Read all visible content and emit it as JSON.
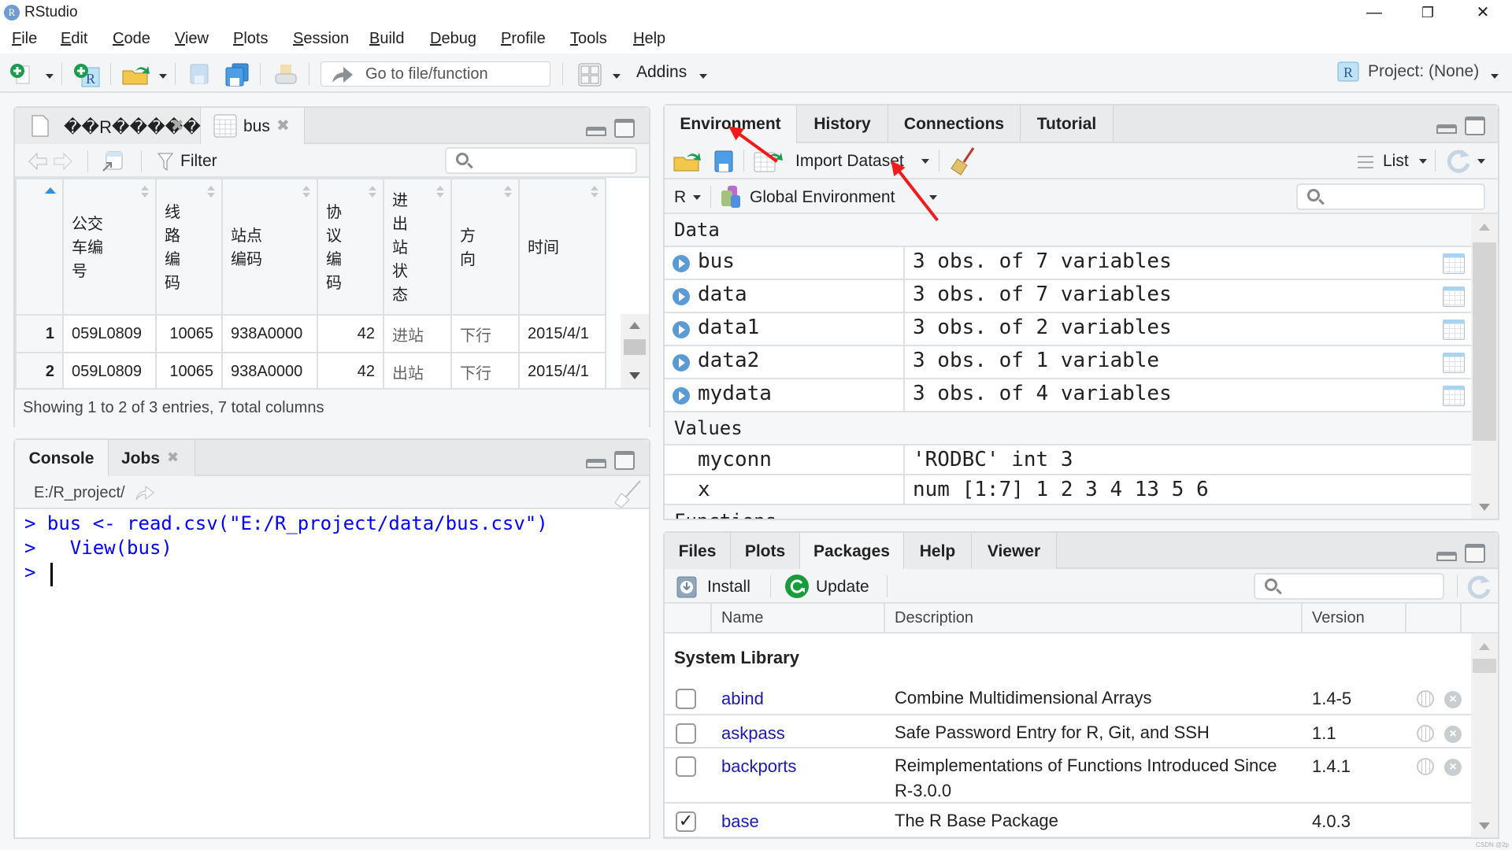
{
  "window": {
    "title": "RStudio",
    "logo": "R",
    "controls": {
      "minimize": "—",
      "restore": "❐",
      "close": "✕"
    }
  },
  "menu": [
    {
      "key": "F",
      "rest": "ile"
    },
    {
      "key": "E",
      "rest": "dit"
    },
    {
      "key": "C",
      "rest": "ode"
    },
    {
      "key": "V",
      "rest": "iew"
    },
    {
      "key": "P",
      "rest": "lots"
    },
    {
      "key": "S",
      "rest": "ession"
    },
    {
      "key": "B",
      "rest": "uild"
    },
    {
      "key": "D",
      "rest": "ebug"
    },
    {
      "key": "P",
      "rest": "rofile"
    },
    {
      "key": "T",
      "rest": "ools"
    },
    {
      "key": "H",
      "rest": "elp"
    }
  ],
  "toolbar": {
    "goto_placeholder": "Go to file/function",
    "addins_label": "Addins",
    "project_label": "Project: (None)"
  },
  "source_pane": {
    "tabs": [
      {
        "label": "��R�����",
        "icon": "file-icon",
        "closable": true
      },
      {
        "label": "bus",
        "icon": "table-icon",
        "closable": true,
        "active": true
      }
    ],
    "filter_label": "Filter",
    "search_placeholder": "",
    "columns": [
      "",
      "公交\n车编\n号",
      "线\n路\n编\n码",
      "站点\n编码",
      "协\n议\n编\n码",
      "进\n出\n站\n状\n态",
      "方\n向",
      "时间"
    ],
    "rows": [
      {
        "n": "1",
        "cells": [
          "059L0809",
          "10065",
          "938A0000",
          "42",
          "进站",
          "下行",
          "2015/4/1"
        ]
      },
      {
        "n": "2",
        "cells": [
          "059L0809",
          "10065",
          "938A0000",
          "42",
          "出站",
          "下行",
          "2015/4/1"
        ]
      }
    ],
    "footer": "Showing 1 to 2 of 3 entries, 7 total columns"
  },
  "console_pane": {
    "tabs": [
      {
        "label": "Console",
        "active": true
      },
      {
        "label": "Jobs",
        "closable": true
      }
    ],
    "path": "E:/R_project/",
    "lines": [
      "> bus <- read.csv(\"E:/R_project/data/bus.csv\")",
      ">   View(bus)",
      "> "
    ]
  },
  "env_pane": {
    "tabs": [
      {
        "label": "Environment",
        "active": true
      },
      {
        "label": "History"
      },
      {
        "label": "Connections"
      },
      {
        "label": "Tutorial"
      }
    ],
    "import_label": "Import Dataset",
    "view_mode": "List",
    "language": "R",
    "scope": "Global Environment",
    "sections": {
      "data": "Data",
      "values": "Values",
      "functions": "Functions"
    },
    "data_items": [
      {
        "name": "bus",
        "value": "3 obs. of 7 variables"
      },
      {
        "name": "data",
        "value": "3 obs. of 7 variables"
      },
      {
        "name": "data1",
        "value": "3 obs. of 2 variables"
      },
      {
        "name": "data2",
        "value": "3 obs. of 1 variable"
      },
      {
        "name": "mydata",
        "value": "3 obs. of 4 variables"
      }
    ],
    "value_items": [
      {
        "name": "myconn",
        "value": "'RODBC' int 3"
      },
      {
        "name": "x",
        "value": "num [1:7] 1 2 3 4 13 5 6"
      }
    ]
  },
  "packages_pane": {
    "tabs": [
      {
        "label": "Files"
      },
      {
        "label": "Plots"
      },
      {
        "label": "Packages",
        "active": true
      },
      {
        "label": "Help"
      },
      {
        "label": "Viewer"
      }
    ],
    "install_label": "Install",
    "update_label": "Update",
    "columns": [
      "Name",
      "Description",
      "Version"
    ],
    "section": "System Library",
    "packages": [
      {
        "name": "abind",
        "description": "Combine Multidimensional Arrays",
        "version": "1.4-5",
        "loaded": false
      },
      {
        "name": "askpass",
        "description": "Safe Password Entry for R, Git, and SSH",
        "version": "1.1",
        "loaded": false
      },
      {
        "name": "backports",
        "description": "Reimplementations of Functions Introduced Since R-3.0.0",
        "version": "1.4.1",
        "loaded": false
      },
      {
        "name": "base",
        "description": "The R Base Package",
        "version": "4.0.3",
        "loaded": true
      }
    ],
    "check_mark": "✓",
    "remove_glyph": "×"
  },
  "watermark": "CSDN @2p",
  "colors": {
    "annotation_arrow": "#f21b1b",
    "console_text": "#0000ff",
    "package_link": "#1a1ab4",
    "sort_active": "#2f8ee5"
  }
}
